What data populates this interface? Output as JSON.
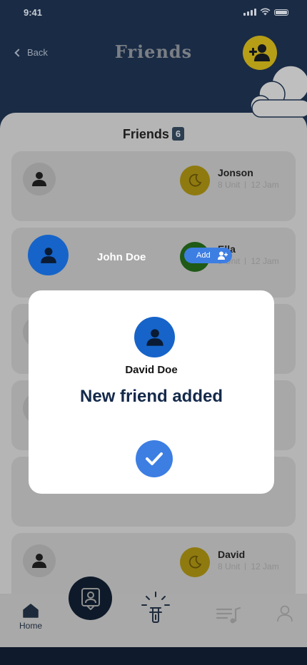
{
  "status_bar": {
    "time": "9:41"
  },
  "header": {
    "back_label": "Back",
    "title": "Friends"
  },
  "friends_section": {
    "title": "Friends",
    "count": "6"
  },
  "friends": [
    {
      "name": "Jonson",
      "units": "8 Unit",
      "date": "12 Jam"
    },
    {
      "name": "Ella",
      "units": "8 Unit",
      "date": "12 Jam"
    },
    {
      "name": "",
      "units": "",
      "date": ""
    },
    {
      "name": "",
      "units": "",
      "date": ""
    },
    {
      "name": "",
      "units": "",
      "date": ""
    },
    {
      "name": "David",
      "units": "8 Unit",
      "date": "12 Jam"
    }
  ],
  "suggestion": {
    "name": "John Doe",
    "add_label": "Add"
  },
  "bottom_nav": {
    "home_label": "Home"
  },
  "modal": {
    "name": "David Doe",
    "title": "New friend added"
  },
  "colors": {
    "header_bg": "#1a2b45",
    "accent_blue": "#3d7ee3",
    "avatar_blue": "#1664c9",
    "gold": "#b69e17",
    "title_navy": "#14294a"
  }
}
